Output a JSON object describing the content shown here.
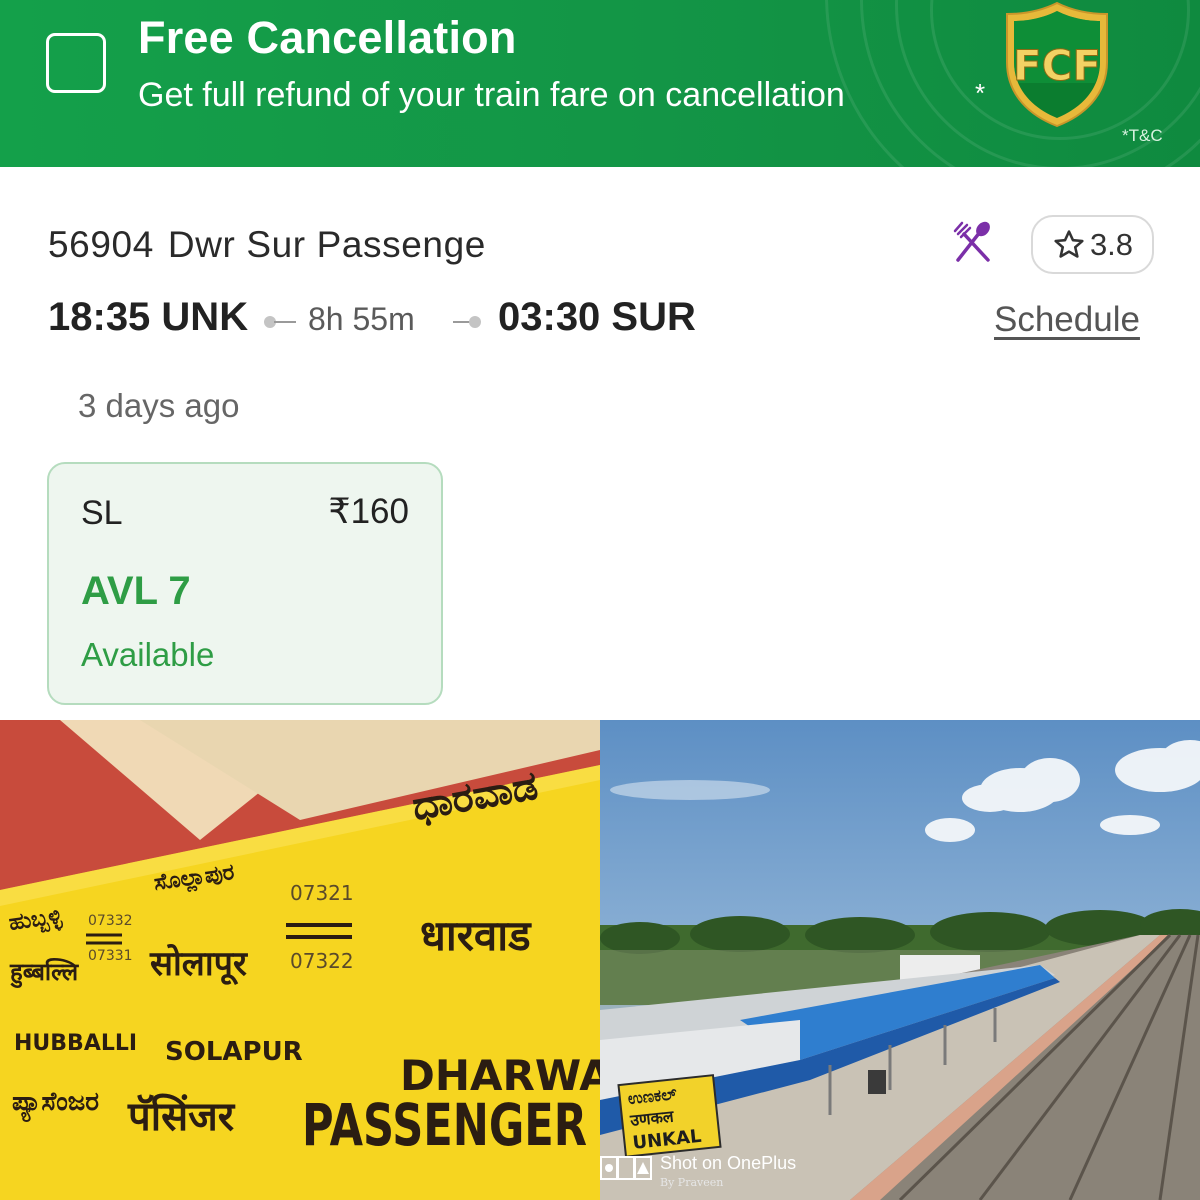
{
  "banner": {
    "title": "Free Cancellation",
    "subtitle": "Get full refund of your train fare on cancellation",
    "asterisk": "*",
    "badge": "FCF",
    "terms": "*T&C",
    "colors": {
      "background": "#139546",
      "badge_gold": "#e7b93a",
      "badge_green": "#0b7d2f"
    }
  },
  "train": {
    "number": "56904",
    "name": "Dwr Sur Passenge",
    "pantry_icon": "fork-knife-icon",
    "rating": "3.8",
    "rating_icon": "star-outline-icon",
    "departure": "18:35 UNK",
    "duration": "8h 55m",
    "arrival": "03:30 SUR",
    "schedule_label": "Schedule",
    "updated": "3 days ago"
  },
  "class_card": {
    "class": "SL",
    "fare": "₹160",
    "status": "AVL 7",
    "status_label": "Available",
    "colors": {
      "available_green": "#2e9d45",
      "card_bg": "#eef6ef"
    }
  },
  "photo_left": {
    "board": {
      "top_right": "ಧಾರವಾಡ",
      "mid_kannada": "ಸೊಲ್ಲಾಪುರ",
      "left_kannada": "ಹುಬ್ಬಳ್ಳಿ",
      "num_a_top": "07332",
      "num_a_bottom": "07331",
      "num_b_top": "07321",
      "num_b_bottom": "07322",
      "hindi_hubballi": "हुब्बल्लि",
      "hindi_solapur": "सोलापूर",
      "hindi_dharwad": "धारवाड",
      "en_hubballi": "HUBBALLI",
      "en_solapur": "SOLAPUR",
      "en_dharwad": "DHARWAD",
      "kannada_passenger": "ಪ್ಯಾಸೆಂಜರ",
      "hindi_passenger": "पॅसिंजर",
      "en_passenger": "PASSENGER"
    }
  },
  "photo_right": {
    "station_board_kannada": "ಉಣಕಲ್",
    "station_board_hindi": "उणकल",
    "station_board_en": "UNKAL",
    "watermark": "Shot on OnePlus",
    "watermark_by": "By Praveen"
  }
}
